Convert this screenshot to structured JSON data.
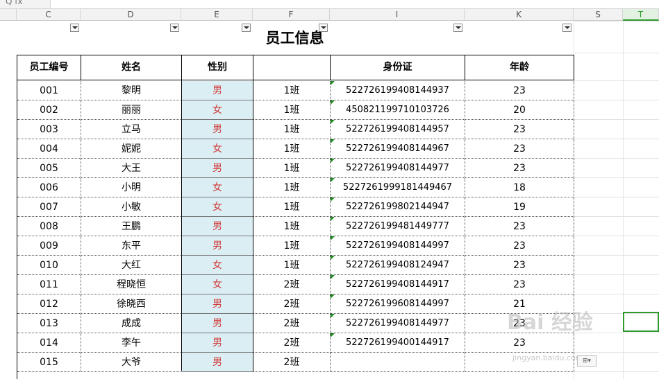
{
  "formula_bar": {
    "icons": "Q  fx",
    "value": ""
  },
  "columns": [
    {
      "label": "C",
      "active": false
    },
    {
      "label": "D",
      "active": false
    },
    {
      "label": "E",
      "active": false
    },
    {
      "label": "F",
      "active": false
    },
    {
      "label": "I",
      "active": false
    },
    {
      "label": "K",
      "active": false
    },
    {
      "label": "S",
      "active": false
    },
    {
      "label": "T",
      "active": true
    }
  ],
  "table": {
    "title": "员工信息",
    "headers": [
      "员工编号",
      "姓名",
      "性别",
      "",
      "身份证",
      "年龄"
    ],
    "rows": [
      {
        "id": "001",
        "name": "黎明",
        "sex": "男",
        "cls": "1班",
        "idcard": "522726199408144937",
        "age": "23"
      },
      {
        "id": "002",
        "name": "丽丽",
        "sex": "女",
        "cls": "1班",
        "idcard": "450821199710103726",
        "age": "20"
      },
      {
        "id": "003",
        "name": "立马",
        "sex": "男",
        "cls": "1班",
        "idcard": "522726199408144957",
        "age": "23"
      },
      {
        "id": "004",
        "name": "妮妮",
        "sex": "女",
        "cls": "1班",
        "idcard": "522726199408144967",
        "age": "23"
      },
      {
        "id": "005",
        "name": "大王",
        "sex": "男",
        "cls": "1班",
        "idcard": "522726199408144977",
        "age": "23"
      },
      {
        "id": "006",
        "name": "小明",
        "sex": "女",
        "cls": "1班",
        "idcard": "5227261999181449467",
        "age": "18"
      },
      {
        "id": "007",
        "name": "小敏",
        "sex": "女",
        "cls": "1班",
        "idcard": "522726199802144947",
        "age": "19"
      },
      {
        "id": "008",
        "name": "王鹏",
        "sex": "男",
        "cls": "1班",
        "idcard": "522726199481449777",
        "age": "23"
      },
      {
        "id": "009",
        "name": "东平",
        "sex": "男",
        "cls": "1班",
        "idcard": "522726199408144997",
        "age": "23"
      },
      {
        "id": "010",
        "name": "大红",
        "sex": "女",
        "cls": "1班",
        "idcard": "522726199408124947",
        "age": "23"
      },
      {
        "id": "011",
        "name": "程晓恒",
        "sex": "女",
        "cls": "2班",
        "idcard": "522726199408144917",
        "age": "23"
      },
      {
        "id": "012",
        "name": "徐晓西",
        "sex": "男",
        "cls": "2班",
        "idcard": "522726199608144997",
        "age": "21"
      },
      {
        "id": "013",
        "name": "成成",
        "sex": "男",
        "cls": "2班",
        "idcard": "522726199408144977",
        "age": "23"
      },
      {
        "id": "014",
        "name": "李午",
        "sex": "男",
        "cls": "2班",
        "idcard": "522726199400144917",
        "age": "23"
      },
      {
        "id": "015",
        "name": "大爷",
        "sex": "男",
        "cls": "2班",
        "idcard": "",
        "age": ""
      }
    ]
  },
  "watermark": {
    "text": "Bai 经验",
    "sub": "jingyan.baidu.com"
  },
  "paste_options": {
    "label": "⊞▾"
  }
}
